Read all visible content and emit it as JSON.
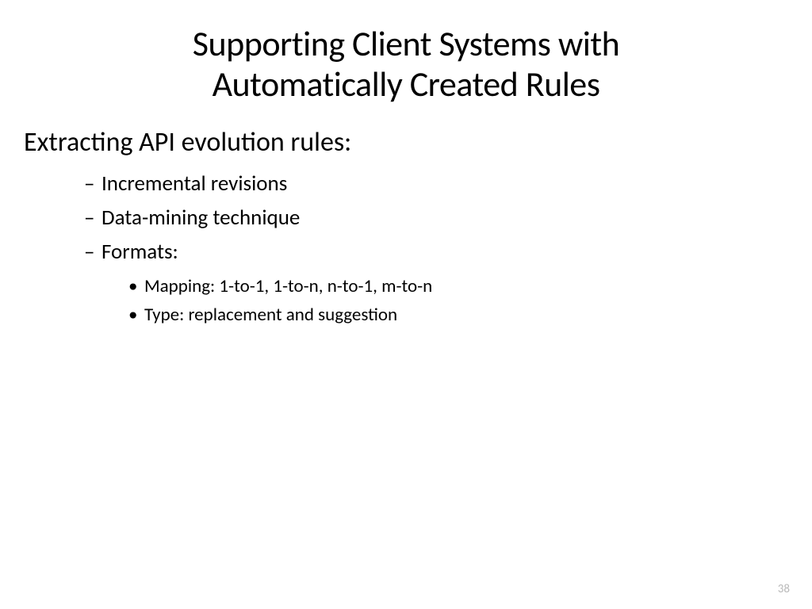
{
  "slide": {
    "title_line1": "Supporting Client Systems with",
    "title_line2": "Automatically Created Rules",
    "subtitle": "Extracting API evolution rules:",
    "bullets": {
      "item0": "Incremental revisions",
      "item1": "Data-mining technique",
      "item2": "Formats:",
      "sub0": "Mapping: 1-to-1, 1-to-n, n-to-1, m-to-n",
      "sub1": "Type: replacement and suggestion"
    },
    "page_number": "38"
  }
}
